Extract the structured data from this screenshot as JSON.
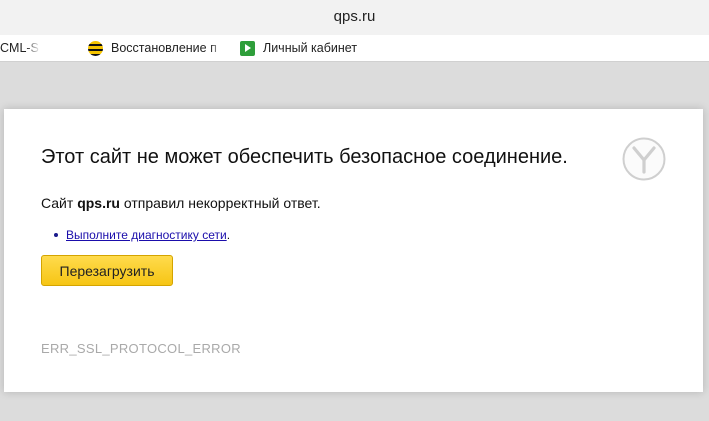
{
  "window": {
    "title": "qps.ru"
  },
  "bookmarks": [
    {
      "label": "CML-S",
      "icon": "page-icon"
    },
    {
      "label": "Восстановление п",
      "icon": "beeline-icon"
    },
    {
      "label": "Личный кабинет",
      "icon": "green-arrow-icon"
    }
  ],
  "error_page": {
    "heading": "Этот сайт не может обеспечить безопасное соединение.",
    "message_prefix": "Сайт",
    "message_site": "qps.ru",
    "message_suffix": "отправил некорректный ответ.",
    "suggestion_link": "Выполните диагностику сети",
    "suggestion_tail": ".",
    "reload_button": "Перезагрузить",
    "error_code": "ERR_SSL_PROTOCOL_ERROR",
    "logo_icon": "yandex-browser-logo-icon"
  },
  "colors": {
    "button_yellow": "#ffdb4d",
    "link_blue": "#1a0dab",
    "error_code_gray": "#a9a9a9"
  }
}
